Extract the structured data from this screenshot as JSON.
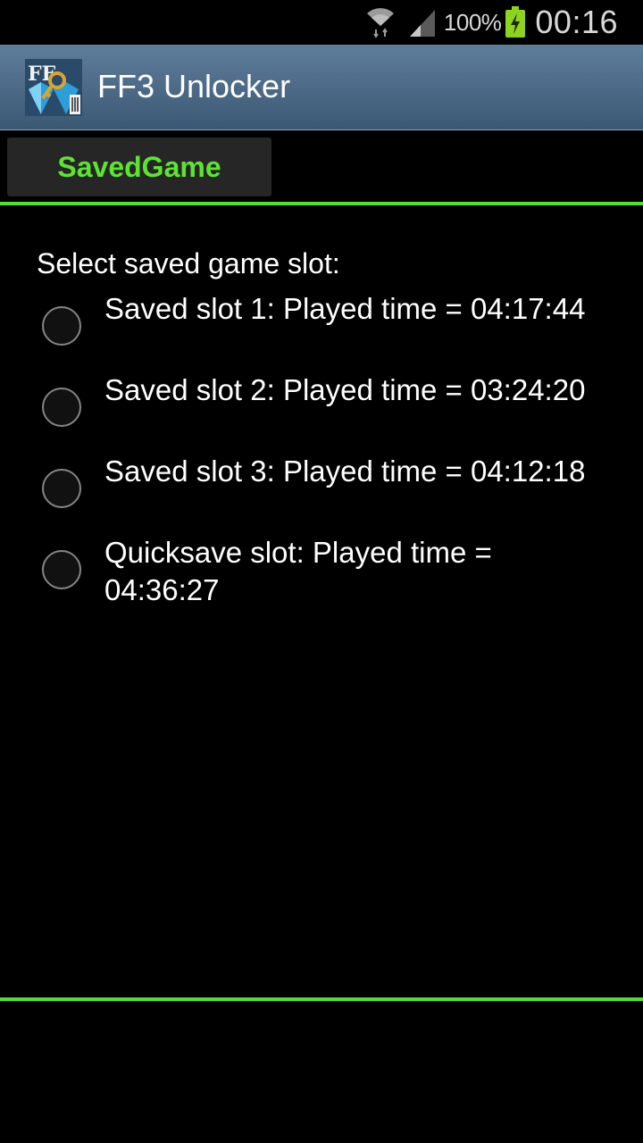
{
  "status_bar": {
    "battery_percent": "100%",
    "time": "00:16",
    "icons": [
      "wifi-icon",
      "signal-icon",
      "battery-charging-icon"
    ]
  },
  "action_bar": {
    "title": "FF3 Unlocker",
    "icon": "app-icon"
  },
  "tabs": [
    {
      "label": "SavedGame"
    }
  ],
  "main": {
    "prompt": "Select saved game slot:",
    "options": [
      {
        "label": "Saved slot 1: Played time = 04:17:44"
      },
      {
        "label": "Saved slot 2: Played time = 03:24:20"
      },
      {
        "label": "Saved slot 3: Played time = 04:12:18"
      },
      {
        "label": "Quicksave slot: Played time = 04:36:27"
      }
    ]
  },
  "colors": {
    "accent": "#52de34",
    "tab_text": "#5de432",
    "action_bar": "#4c6a87"
  }
}
